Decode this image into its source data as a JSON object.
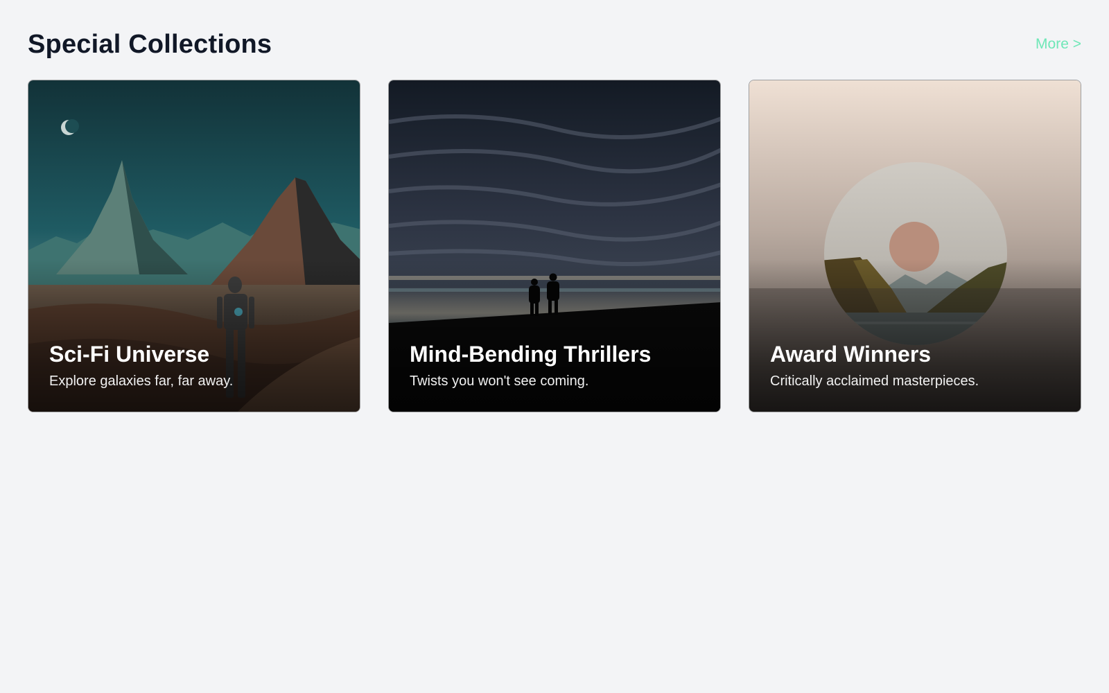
{
  "section": {
    "title": "Special Collections",
    "more_label": "More >"
  },
  "cards": [
    {
      "title": "Sci-Fi Universe",
      "subtitle": "Explore galaxies far, far away.",
      "image_icon": "scifi-landscape-robot-image"
    },
    {
      "title": "Mind-Bending Thrillers",
      "subtitle": "Twists you won't see coming.",
      "image_icon": "stormy-sky-silhouettes-image"
    },
    {
      "title": "Award Winners",
      "subtitle": "Critically acclaimed masterpieces.",
      "image_icon": "mountain-lake-circle-image"
    }
  ],
  "colors": {
    "background": "#f3f4f6",
    "title": "#111827",
    "accent": "#6ee7b7"
  }
}
